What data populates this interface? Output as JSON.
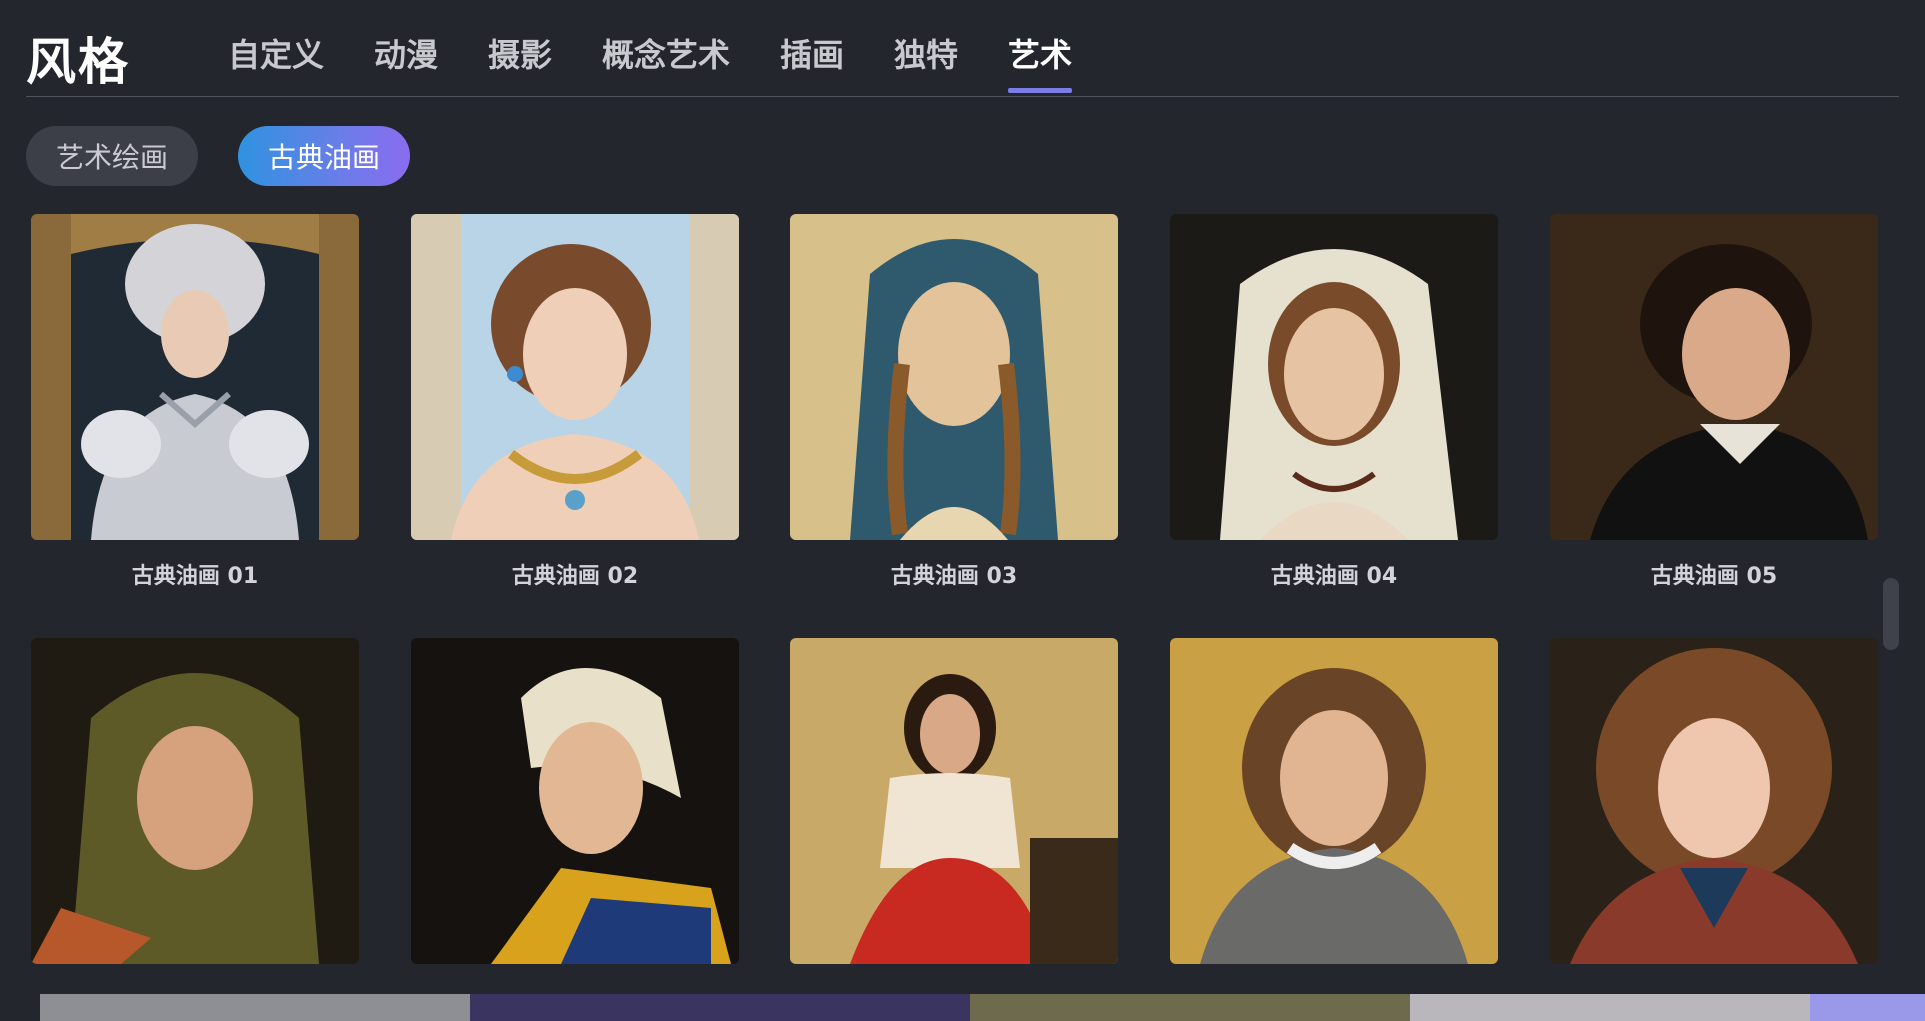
{
  "header": {
    "title": "风格",
    "tabs": [
      {
        "label": "自定义"
      },
      {
        "label": "动漫"
      },
      {
        "label": "摄影"
      },
      {
        "label": "概念艺术"
      },
      {
        "label": "插画"
      },
      {
        "label": "独特"
      },
      {
        "label": "艺术",
        "active": true
      }
    ]
  },
  "filters": {
    "chips": [
      {
        "label": "艺术绘画",
        "selected": false
      },
      {
        "label": "古典油画",
        "selected": true
      }
    ]
  },
  "gallery": {
    "items": [
      {
        "label": "古典油画 01"
      },
      {
        "label": "古典油画 02"
      },
      {
        "label": "古典油画 03"
      },
      {
        "label": "古典油画 04"
      },
      {
        "label": "古典油画 05"
      },
      {
        "label": ""
      },
      {
        "label": ""
      },
      {
        "label": ""
      },
      {
        "label": ""
      },
      {
        "label": ""
      }
    ]
  },
  "colors": {
    "background": "#24262d",
    "accent": "#7d7be8",
    "chip_gradient_start": "#2f93e0",
    "chip_gradient_end": "#8b6cf0"
  }
}
